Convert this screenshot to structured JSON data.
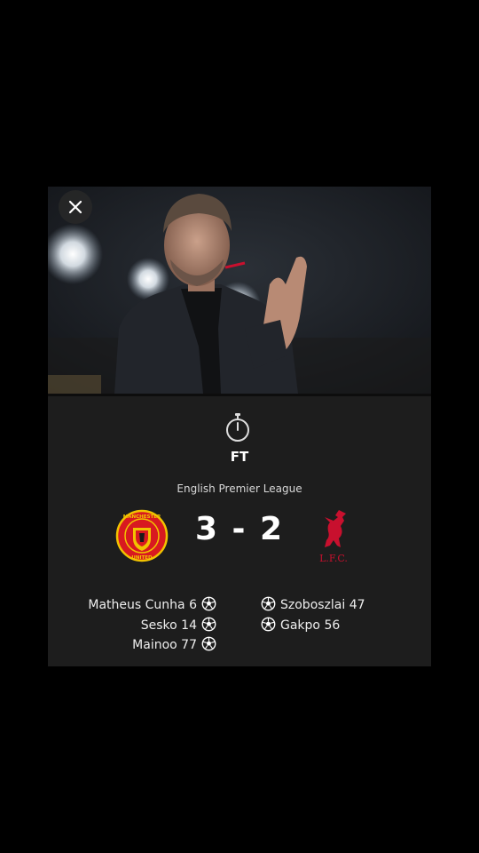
{
  "match": {
    "status": "FT",
    "league": "English Premier League",
    "score": "3 - 2"
  },
  "home_team": {
    "crest_icon": "manchester-united-crest-icon",
    "crest_text_top": "MANCHESTER",
    "crest_text_bottom": "UNITED",
    "scorers": [
      {
        "name": "Matheus Cunha",
        "minute": "6"
      },
      {
        "name": "Sesko",
        "minute": "14"
      },
      {
        "name": "Mainoo",
        "minute": "77"
      }
    ]
  },
  "away_team": {
    "crest_icon": "liverpool-crest-icon",
    "crest_text": "L.F.C.",
    "scorers": [
      {
        "name": "Szoboszlai",
        "minute": "47"
      },
      {
        "name": "Gakpo",
        "minute": "56"
      }
    ]
  },
  "colors": {
    "background": "#000000",
    "card": "#1d1d1d",
    "text": "#ffffff",
    "man_utd_red": "#d81920",
    "man_utd_gold": "#f2c300",
    "liverpool_red": "#c8102e"
  }
}
